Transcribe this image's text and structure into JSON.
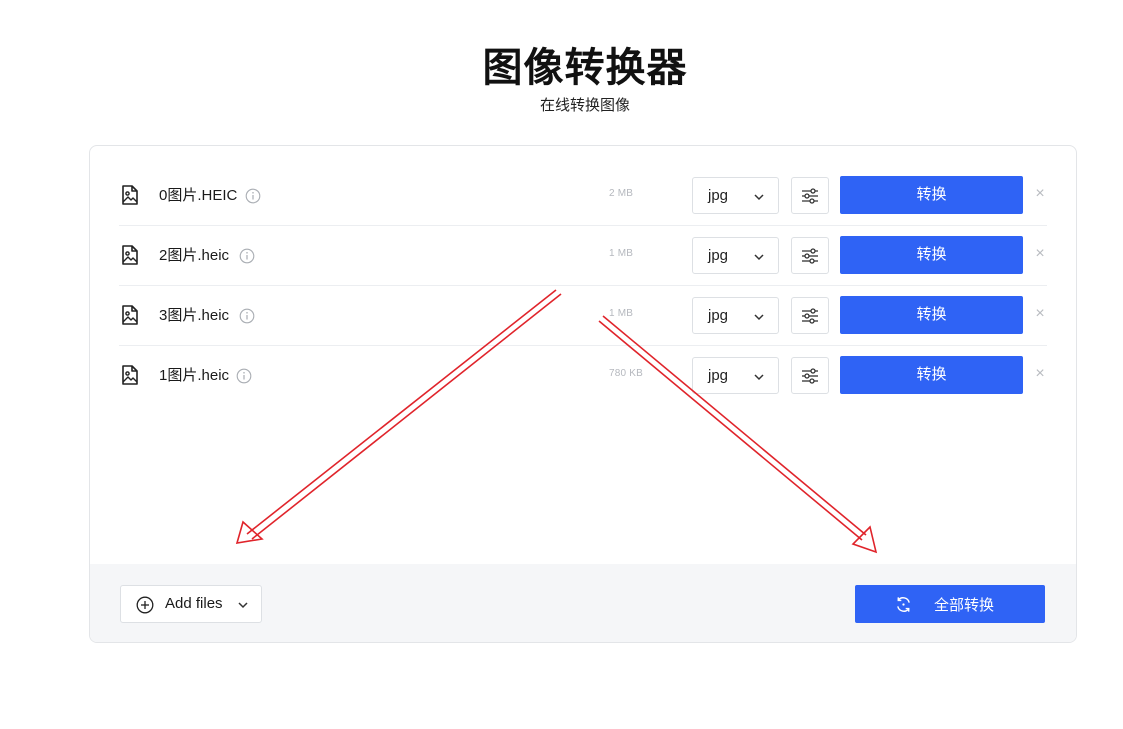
{
  "header": {
    "title": "图像转换器",
    "subtitle": "在线转换图像"
  },
  "files": [
    {
      "name": "0图片.HEIC",
      "size": "2 MB",
      "format": "jpg",
      "convert_label": "转换",
      "remove_label": "×"
    },
    {
      "name": "2图片.heic",
      "size": "1 MB",
      "format": "jpg",
      "convert_label": "转换",
      "remove_label": "×"
    },
    {
      "name": "3图片.heic",
      "size": "1 MB",
      "format": "jpg",
      "convert_label": "转换",
      "remove_label": "×"
    },
    {
      "name": "1图片.heic",
      "size": "780 KB",
      "format": "jpg",
      "convert_label": "转换",
      "remove_label": "×"
    }
  ],
  "footer": {
    "add_files_label": "Add files",
    "convert_all_label": "全部转换"
  },
  "colors": {
    "accent": "#2f63f5",
    "annotation_arrow": "#e0242b"
  },
  "icons": {
    "file": "image-file-icon",
    "info": "info-icon",
    "settings": "sliders-icon",
    "dropdown": "chevron-down-icon",
    "add": "plus-circle-icon",
    "convert_all": "refresh-icon"
  }
}
